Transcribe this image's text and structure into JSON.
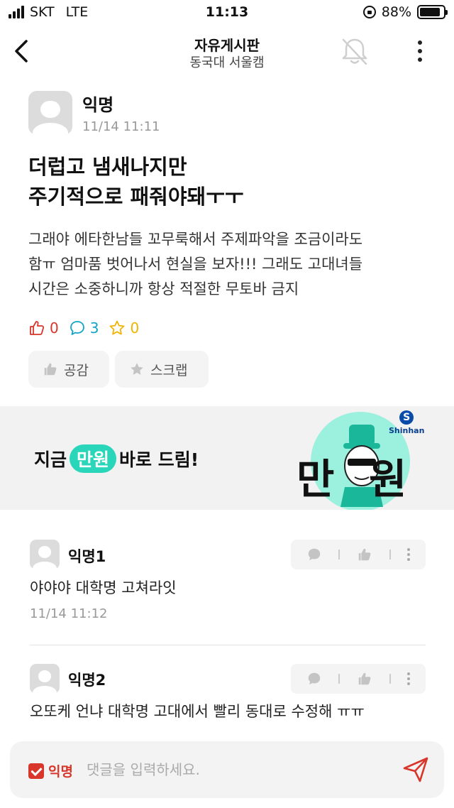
{
  "status_bar": {
    "carrier": "SKT",
    "network": "LTE",
    "time": "11:13",
    "battery": "88%",
    "battery_level": 0.88
  },
  "nav": {
    "title": "자유게시판",
    "subtitle": "동국대 서울캠",
    "icons": [
      "back-icon",
      "bell-off-icon",
      "more-icon"
    ]
  },
  "post": {
    "author": "익명",
    "timestamp": "11/14 11:11",
    "title_lines": [
      "더럽고 냄새나지만",
      "주기적으로 패줘야돼ㅜㅜ"
    ],
    "body_lines": [
      "그래야 에타한남들 꼬무룩해서 주제파악을 조금이라도",
      "함ㅠ 엄마품 벗어나서 현실을 보자!!! 그래도 고대녀들",
      "시간은 소중하니까 항상 적절한 무토바 금지"
    ],
    "likes": "0",
    "comments": "3",
    "scraps": "0",
    "sympathy_label": "공감",
    "scrap_label": "스크랩"
  },
  "ad": {
    "prefix": "지금",
    "highlight": "만원",
    "suffix": "바로 드림!",
    "brand": "Shinhan",
    "big_left": "만",
    "big_right": "원"
  },
  "comments": [
    {
      "author": "익명1",
      "text": "야야야 대학명 고쳐라잇",
      "timestamp": "11/14 11:12"
    },
    {
      "author": "익명2",
      "text": "오또케 언냐 대학명 고대에서 빨리 동대로 수정해 ㅠㅠ"
    }
  ],
  "input": {
    "anonymous_label": "익명",
    "placeholder": "댓글을 입력하세요."
  },
  "colors": {
    "accent_red": "#d8362a",
    "comment_teal": "#12a4c8",
    "scrap_yellow": "#f0b400",
    "ad_mint": "#2ad6b9"
  }
}
